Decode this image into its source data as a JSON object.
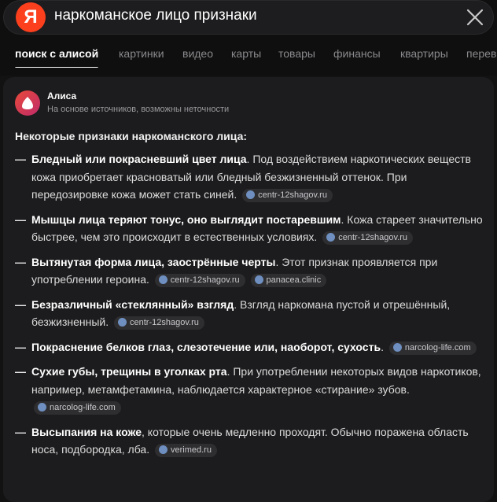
{
  "search": {
    "logo_letter": "Я",
    "query": "наркоманское лицо признаки"
  },
  "tabs": [
    {
      "label": "поиск с алисой",
      "active": true
    },
    {
      "label": "картинки"
    },
    {
      "label": "видео"
    },
    {
      "label": "карты"
    },
    {
      "label": "товары"
    },
    {
      "label": "финансы"
    },
    {
      "label": "квартиры"
    },
    {
      "label": "перев"
    }
  ],
  "alice": {
    "name": "Алиса",
    "subtitle": "На основе источников, возможны неточности"
  },
  "answer": {
    "intro": "Некоторые признаки наркоманского лица:",
    "items": [
      {
        "bold": "Бледный или покрасневший цвет лица",
        "text": ". Под воздействием наркотических веществ кожа приобретает красноватый или бледный безжизненный оттенок. При передозировке кожа может стать синей.",
        "sources": [
          "centr-12shagov.ru"
        ]
      },
      {
        "bold": "Мышцы лица теряют тонус, оно выглядит постаревшим",
        "text": ". Кожа стареет значительно быстрее, чем это происходит в естественных условиях.",
        "sources": [
          "centr-12shagov.ru"
        ]
      },
      {
        "bold": "Вытянутая форма лица, заострённые черты",
        "text": ". Этот признак проявляется при употреблении героина.",
        "sources": [
          "centr-12shagov.ru",
          "panacea.clinic"
        ]
      },
      {
        "bold": "Безразличный «стеклянный» взгляд",
        "text": ". Взгляд наркомана пустой и отрешённый, безжизненный.",
        "sources": [
          "centr-12shagov.ru"
        ]
      },
      {
        "bold": "Покраснение белков глаз, слезотечение или, наоборот, сухость",
        "text": ".",
        "sources": [
          "narcolog-life.com"
        ]
      },
      {
        "bold": "Сухие губы, трещины в уголках рта",
        "text": ". При употреблении некоторых видов наркотиков, например, метамфетамина, наблюдается характерное «стирание» зубов.",
        "sources": [
          "narcolog-life.com"
        ]
      },
      {
        "bold": "Высыпания на коже",
        "text": ", которые очень медленно проходят. Обычно поражена область носа, подбородка, лба.",
        "sources": [
          "verimed.ru"
        ]
      }
    ]
  }
}
